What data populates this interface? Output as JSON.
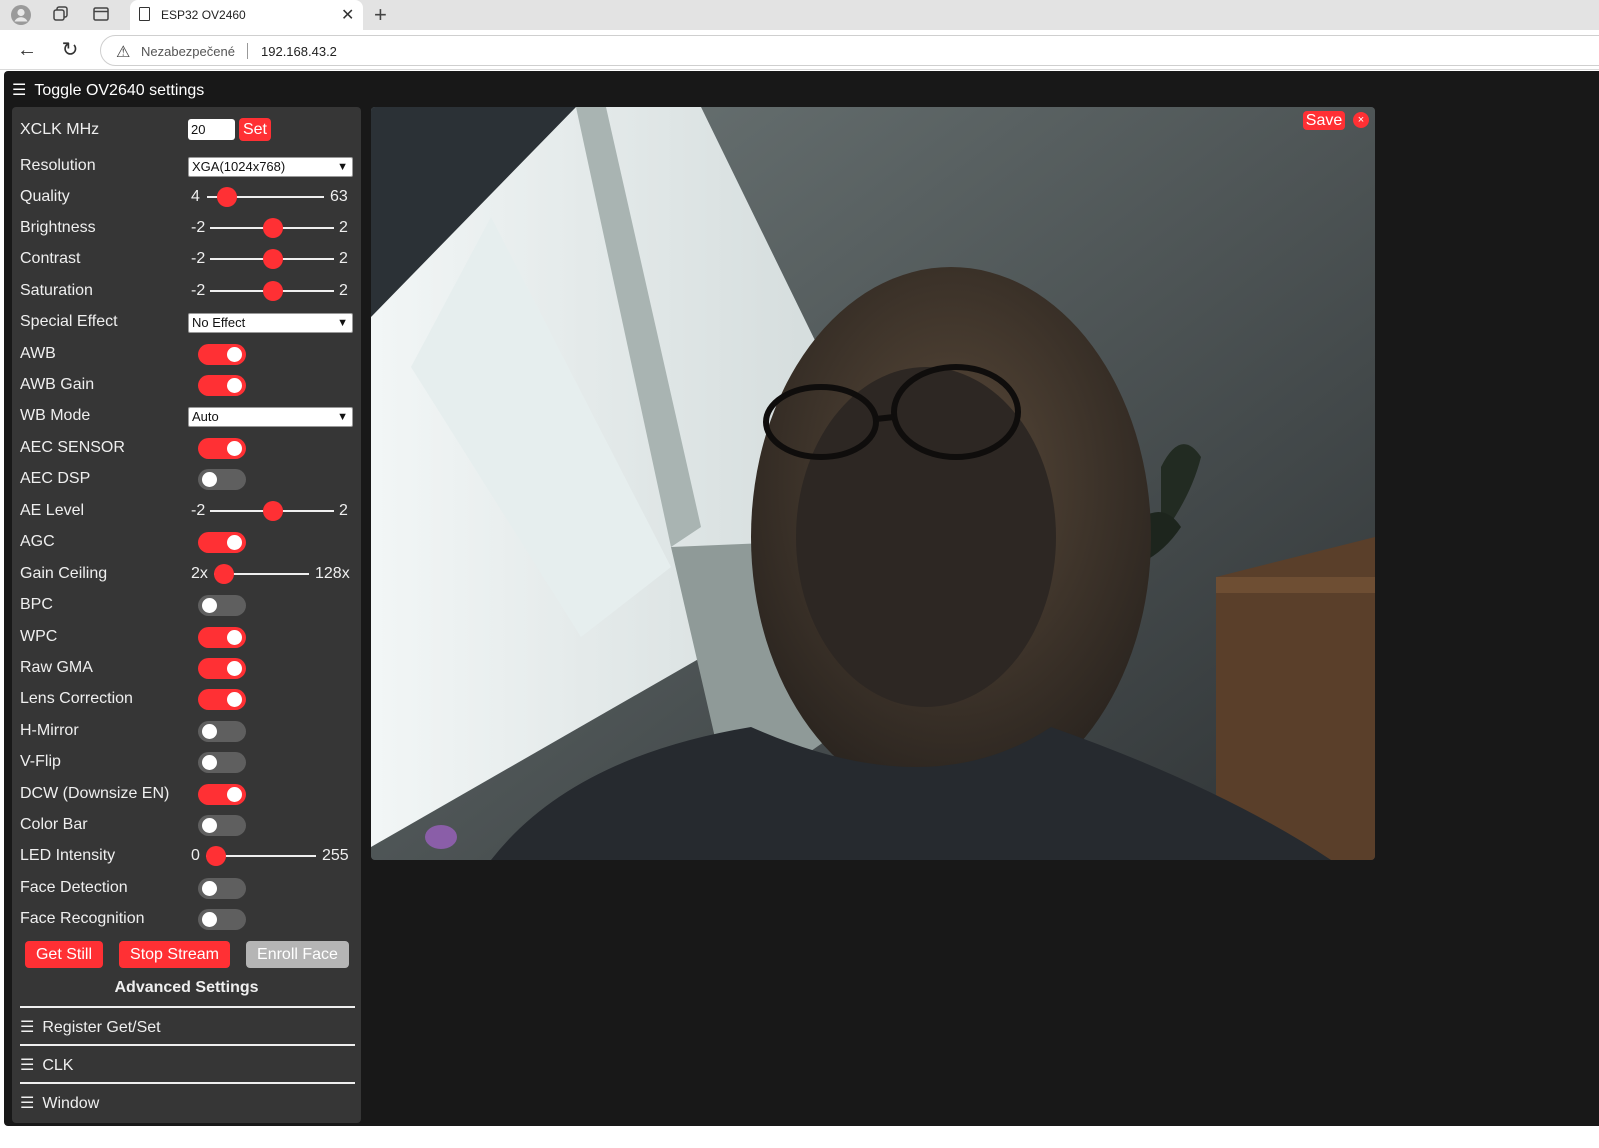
{
  "browser": {
    "tab_title": "ESP32 OV2460",
    "security_label": "Nezabezpečené",
    "url": "192.168.43.2"
  },
  "page": {
    "menu_toggle_label": "Toggle OV2640 settings",
    "accent_color": "#ff3034"
  },
  "settings": {
    "xclk": {
      "label": "XCLK MHz",
      "value": "20",
      "set_label": "Set"
    },
    "resolution": {
      "label": "Resolution",
      "selected": "XGA(1024x768)"
    },
    "quality": {
      "label": "Quality",
      "min": "4",
      "max": "63",
      "level": 0.0
    },
    "brightness": {
      "label": "Brightness",
      "min": "-2",
      "max": "2",
      "value": 0
    },
    "contrast": {
      "label": "Contrast",
      "min": "-2",
      "max": "2",
      "value": 0
    },
    "saturation": {
      "label": "Saturation",
      "min": "-2",
      "max": "2",
      "value": 0
    },
    "special_effect": {
      "label": "Special Effect",
      "selected": "No Effect"
    },
    "awb": {
      "label": "AWB",
      "on": true
    },
    "awb_gain": {
      "label": "AWB Gain",
      "on": true
    },
    "wb_mode": {
      "label": "WB Mode",
      "selected": "Auto"
    },
    "aec_sensor": {
      "label": "AEC SENSOR",
      "on": true
    },
    "aec_dsp": {
      "label": "AEC DSP",
      "on": false
    },
    "ae_level": {
      "label": "AE Level",
      "min": "-2",
      "max": "2",
      "value": 0
    },
    "agc": {
      "label": "AGC",
      "on": true
    },
    "gain_ceiling": {
      "label": "Gain Ceiling",
      "min": "2x",
      "max": "128x",
      "level": 0.0
    },
    "bpc": {
      "label": "BPC",
      "on": false
    },
    "wpc": {
      "label": "WPC",
      "on": true
    },
    "raw_gma": {
      "label": "Raw GMA",
      "on": true
    },
    "lens_correction": {
      "label": "Lens Correction",
      "on": true
    },
    "h_mirror": {
      "label": "H-Mirror",
      "on": false
    },
    "v_flip": {
      "label": "V-Flip",
      "on": false
    },
    "dcw": {
      "label": "DCW (Downsize EN)",
      "on": true
    },
    "color_bar": {
      "label": "Color Bar",
      "on": false
    },
    "led_intensity": {
      "label": "LED Intensity",
      "min": "0",
      "max": "255",
      "value": 0
    },
    "face_detection": {
      "label": "Face Detection",
      "on": false
    },
    "face_recognition": {
      "label": "Face Recognition",
      "on": false
    }
  },
  "actions": {
    "get_still": "Get Still",
    "stop_stream": "Stop Stream",
    "enroll_face": "Enroll Face"
  },
  "advanced": {
    "title": "Advanced Settings",
    "items": [
      "Register Get/Set",
      "CLK",
      "Window"
    ]
  },
  "stream": {
    "save_label": "Save",
    "close_symbol": "×"
  }
}
